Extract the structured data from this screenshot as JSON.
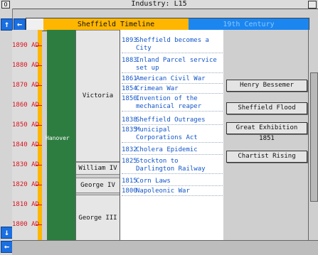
{
  "window": {
    "title": "Industry: L15",
    "close_glyph": "O"
  },
  "header": {
    "era_left": "Sheffield Timeline",
    "era_right": "19th Century"
  },
  "ruler": {
    "ticks": [
      "1890 AD",
      "1880 AD",
      "1870 AD",
      "1860 AD",
      "1850 AD",
      "1840 AD",
      "1830 AD",
      "1820 AD",
      "1810 AD",
      "1800 AD"
    ]
  },
  "green_label": "Hanover",
  "monarchs": [
    "Victoria",
    "William IV",
    "George IV",
    "George III"
  ],
  "events": [
    {
      "year": "1893",
      "text": "Sheffield becomes a City"
    },
    {
      "year": "1883",
      "text": "Inland Parcel service set up"
    },
    {
      "year": "1861",
      "text": "American Civil War"
    },
    {
      "year": "1854",
      "text": "Crimean War"
    },
    {
      "year": "1850",
      "text": "Invention of the mechanical reaper"
    },
    {
      "year": "1838",
      "text": "Sheffield Outrages"
    },
    {
      "year": "1835",
      "text": "Municipal Corporations Act"
    },
    {
      "year": "1832",
      "text": "Cholera Epidemic"
    },
    {
      "year": "1825",
      "text": "Stockton to Darlington Railway"
    },
    {
      "year": "1815",
      "text": "Corn Laws"
    },
    {
      "year": "1800",
      "text": "Napoleonic War"
    }
  ],
  "right_buttons": [
    "Henry Bessemer",
    "Sheffield Flood",
    "Great Exhibition 1851",
    "Chartist Rising"
  ],
  "colors": {
    "accent_orange": "#ffb600",
    "accent_blue": "#1b86f0",
    "ruler_red": "#d8141e",
    "event_blue": "#1356c9",
    "monarch_green": "#2e7d40"
  },
  "icons": [
    "up-arrow-icon",
    "left-arrow-icon",
    "down-arrow-icon"
  ]
}
